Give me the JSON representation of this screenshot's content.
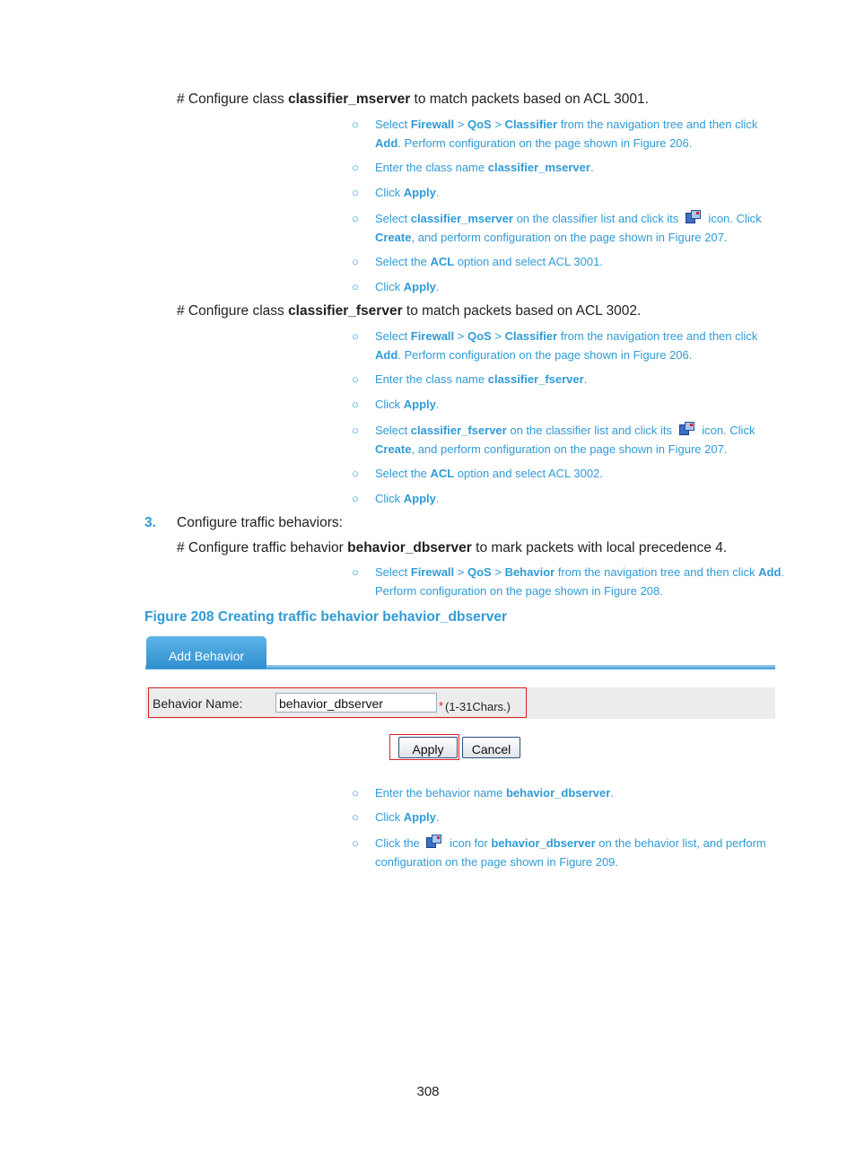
{
  "blocks": [
    {
      "kind": "hash",
      "segs": [
        [
          "t",
          "# Configure class "
        ],
        [
          "b",
          "classifier_mserver"
        ],
        [
          "t",
          " to match packets based on ACL 3001."
        ]
      ]
    },
    {
      "kind": "bullet",
      "segs": [
        [
          "t",
          "Select "
        ],
        [
          "b",
          "Firewall"
        ],
        [
          "t",
          " > "
        ],
        [
          "b",
          "QoS"
        ],
        [
          "t",
          " > "
        ],
        [
          "b",
          "Classifier"
        ],
        [
          "t",
          " from the navigation tree and then click "
        ],
        [
          "b",
          "Add"
        ],
        [
          "t",
          ". Perform configuration on the page shown in "
        ],
        [
          "l",
          "Figure 206"
        ],
        [
          "t",
          "."
        ]
      ]
    },
    {
      "kind": "bullet",
      "segs": [
        [
          "t",
          "Enter the class name "
        ],
        [
          "b",
          "classifier_mserver"
        ],
        [
          "t",
          "."
        ]
      ]
    },
    {
      "kind": "bullet",
      "segs": [
        [
          "t",
          "Click "
        ],
        [
          "b",
          "Apply"
        ],
        [
          "t",
          "."
        ]
      ]
    },
    {
      "kind": "bullet",
      "segs": [
        [
          "t",
          "Select "
        ],
        [
          "b",
          "classifier_mserver"
        ],
        [
          "t",
          " on the classifier list and click its "
        ],
        [
          "i",
          "configure-icon"
        ],
        [
          "t",
          " icon. Click "
        ],
        [
          "b",
          "Create"
        ],
        [
          "t",
          ", and perform configuration on the page shown in "
        ],
        [
          "l",
          "Figure 207"
        ],
        [
          "t",
          "."
        ]
      ]
    },
    {
      "kind": "bullet",
      "segs": [
        [
          "t",
          "Select the "
        ],
        [
          "b",
          "ACL"
        ],
        [
          "t",
          " option and select ACL 3001."
        ]
      ]
    },
    {
      "kind": "bullet",
      "segs": [
        [
          "t",
          "Click "
        ],
        [
          "b",
          "Apply"
        ],
        [
          "t",
          "."
        ]
      ]
    },
    {
      "kind": "hash",
      "segs": [
        [
          "t",
          "# Configure class "
        ],
        [
          "b",
          "classifier_fserver"
        ],
        [
          "t",
          " to match packets based on ACL 3002."
        ]
      ]
    },
    {
      "kind": "bullet",
      "segs": [
        [
          "t",
          "Select "
        ],
        [
          "b",
          "Firewall"
        ],
        [
          "t",
          " > "
        ],
        [
          "b",
          "QoS"
        ],
        [
          "t",
          " > "
        ],
        [
          "b",
          "Classifier"
        ],
        [
          "t",
          " from the navigation tree and then click "
        ],
        [
          "b",
          "Add"
        ],
        [
          "t",
          ". Perform configuration on the page shown in "
        ],
        [
          "l",
          "Figure 206"
        ],
        [
          "t",
          "."
        ]
      ]
    },
    {
      "kind": "bullet",
      "segs": [
        [
          "t",
          "Enter the class name "
        ],
        [
          "b",
          "classifier_fserver"
        ],
        [
          "t",
          "."
        ]
      ]
    },
    {
      "kind": "bullet",
      "segs": [
        [
          "t",
          "Click "
        ],
        [
          "b",
          "Apply"
        ],
        [
          "t",
          "."
        ]
      ]
    },
    {
      "kind": "bullet",
      "segs": [
        [
          "t",
          "Select "
        ],
        [
          "b",
          "classifier_fserver"
        ],
        [
          "t",
          " on the classifier list and click its "
        ],
        [
          "i",
          "configure-icon"
        ],
        [
          "t",
          " icon. Click "
        ],
        [
          "b",
          "Create"
        ],
        [
          "t",
          ", and perform configuration on the page shown in "
        ],
        [
          "l",
          "Figure 207"
        ],
        [
          "t",
          "."
        ]
      ]
    },
    {
      "kind": "bullet",
      "segs": [
        [
          "t",
          "Select the "
        ],
        [
          "b",
          "ACL"
        ],
        [
          "t",
          " option and select ACL 3002."
        ]
      ]
    },
    {
      "kind": "bullet",
      "segs": [
        [
          "t",
          "Click "
        ],
        [
          "b",
          "Apply"
        ],
        [
          "t",
          "."
        ]
      ]
    },
    {
      "kind": "num",
      "label": "3.",
      "segs": [
        [
          "t",
          "Configure traffic behaviors:"
        ]
      ]
    },
    {
      "kind": "hash",
      "segs": [
        [
          "t",
          "# Configure traffic behavior "
        ],
        [
          "b",
          "behavior_dbserver"
        ],
        [
          "t",
          " to mark packets with local precedence 4."
        ]
      ]
    },
    {
      "kind": "bullet",
      "segs": [
        [
          "t",
          "Select "
        ],
        [
          "b",
          "Firewall"
        ],
        [
          "t",
          " > "
        ],
        [
          "b",
          "QoS"
        ],
        [
          "t",
          " > "
        ],
        [
          "b",
          "Behavior"
        ],
        [
          "t",
          " from the navigation tree and then click "
        ],
        [
          "b",
          "Add"
        ],
        [
          "t",
          ". Perform configuration on the page shown in "
        ],
        [
          "l",
          "Figure 208"
        ],
        [
          "t",
          "."
        ]
      ]
    },
    {
      "kind": "bullet",
      "segs": [
        [
          "t",
          "Enter the behavior name "
        ],
        [
          "b",
          "behavior_dbserver"
        ],
        [
          "t",
          "."
        ]
      ]
    },
    {
      "kind": "bullet",
      "segs": [
        [
          "t",
          "Click "
        ],
        [
          "b",
          "Apply"
        ],
        [
          "t",
          "."
        ]
      ]
    },
    {
      "kind": "bullet",
      "segs": [
        [
          "t",
          "Click the "
        ],
        [
          "i",
          "configure-icon"
        ],
        [
          "t",
          " icon for "
        ],
        [
          "b",
          "behavior_dbserver"
        ],
        [
          "t",
          " on the behavior list, and perform configuration on the page shown in "
        ],
        [
          "l",
          "Figure 209"
        ],
        [
          "t",
          "."
        ]
      ]
    }
  ],
  "bullet_glyph": "○",
  "figure": {
    "caption": "Figure 208 Creating traffic behavior behavior_dbserver",
    "tab": "Add Behavior",
    "field_label": "Behavior Name:",
    "field_value": "behavior_dbserver",
    "required_mark": "*",
    "hint": "(1-31Chars.)",
    "apply": "Apply",
    "cancel": "Cancel"
  },
  "colors": {
    "accent": "#2f9bd6",
    "highlight": "#e02020"
  },
  "page_number": "308"
}
